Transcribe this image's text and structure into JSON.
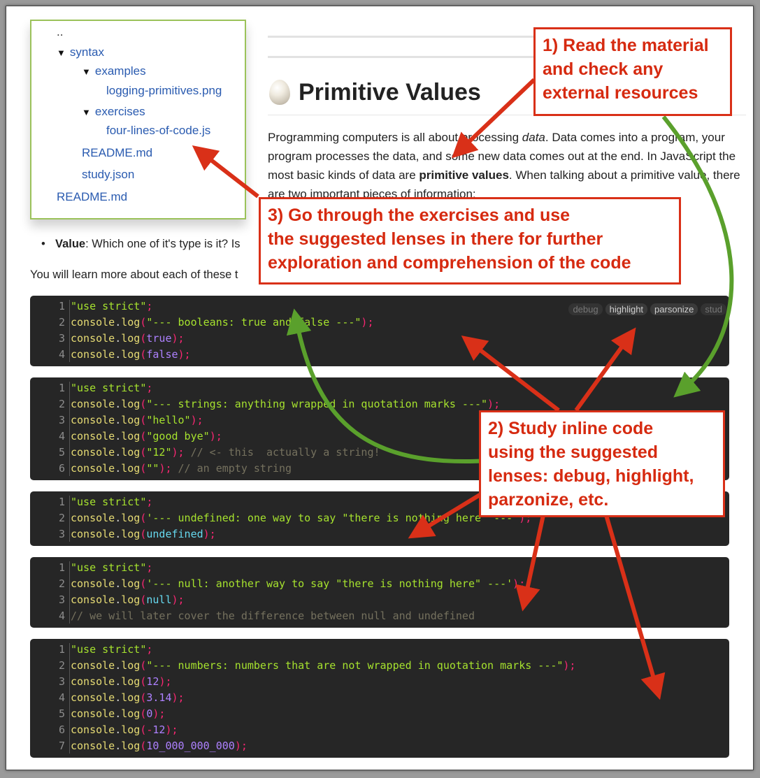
{
  "tree": {
    "up": "..",
    "syntax": "syntax",
    "examples": "examples",
    "logging": "logging-primitives.png",
    "exercises": "exercises",
    "four_lines": "four-lines-of-code.js",
    "readme_inner": "README.md",
    "study": "study.json",
    "readme_root": "README.md"
  },
  "page": {
    "title": "Primitive Values",
    "para_a": "Programming computers is all about processing ",
    "para_em": "data",
    "para_b": ". Data comes into a program, your program processes the data, and some new data comes out at the end. In JavaScript the most basic kinds of data are ",
    "para_strong": "primitive values",
    "para_c": ". When talking about a primitive value, there are two important pieces of information:",
    "bullet_label": "Value",
    "bullet_text": ": Which one of it's type is it? Is",
    "learn_text": "You will learn more about each of these t"
  },
  "lenses": [
    "debug",
    "highlight",
    "parsonize",
    "stud"
  ],
  "callouts": {
    "one": "1) Read the material\nand check any\nexternal resources",
    "two": "2) Study inline code\nusing the suggested\nlenses: debug, highlight,\nparzonize, etc.",
    "three": "3) Go through the exercises and use\nthe suggested lenses in there for further\nexploration and comprehension of the code"
  },
  "colors": {
    "callout_red": "#d93018",
    "arrow_green": "#5aa02c",
    "tree_border": "#9bc25a"
  }
}
